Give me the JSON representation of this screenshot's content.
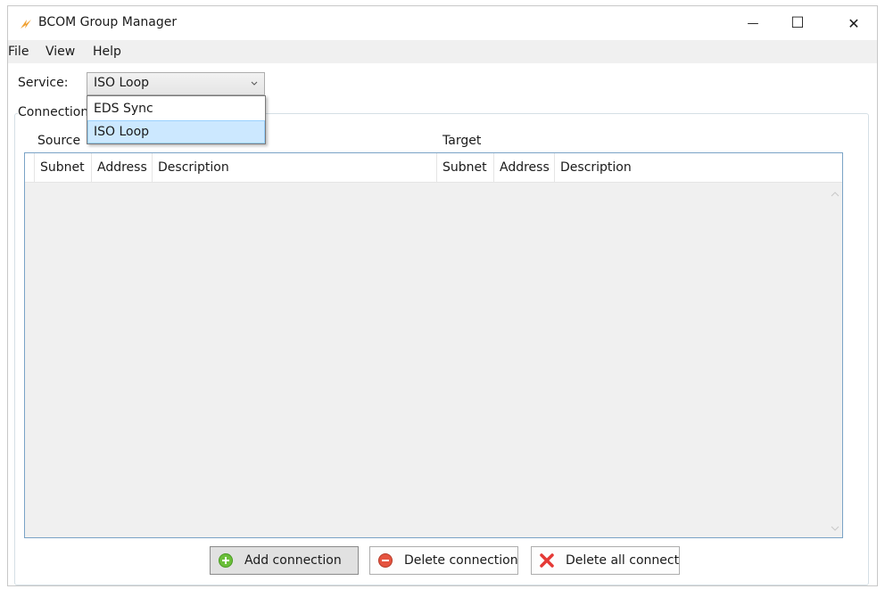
{
  "window": {
    "title": "BCOM Group Manager",
    "controls": {
      "minimize": "—",
      "maximize": "☐",
      "close": "✕"
    }
  },
  "menu": [
    "File",
    "View",
    "Help"
  ],
  "service": {
    "label": "Service:",
    "selected": "ISO Loop",
    "options": [
      "EDS Sync",
      "ISO Loop"
    ],
    "dropdown_open": true
  },
  "group": {
    "label": "Connections"
  },
  "source": {
    "label": "Source",
    "columns": [
      "Subnet",
      "Address",
      "Description"
    ]
  },
  "target": {
    "label": "Target",
    "columns": [
      "Subnet",
      "Address",
      "Description"
    ]
  },
  "buttons": {
    "add": "Add connection",
    "delete": "Delete connection",
    "delete_all": "Delete all connecti"
  },
  "icons": {
    "app": "bolt-icon",
    "add": "plus-circle-icon",
    "delete": "minus-circle-icon",
    "delete_all": "red-x-icon"
  },
  "colors": {
    "add_icon": "#6bbf3a",
    "delete_icon": "#e5533f",
    "delete_all_icon": "#e53935",
    "app_icon": "#f0a030",
    "selection": "#cce8ff",
    "grid_border": "#7aa3c6"
  }
}
